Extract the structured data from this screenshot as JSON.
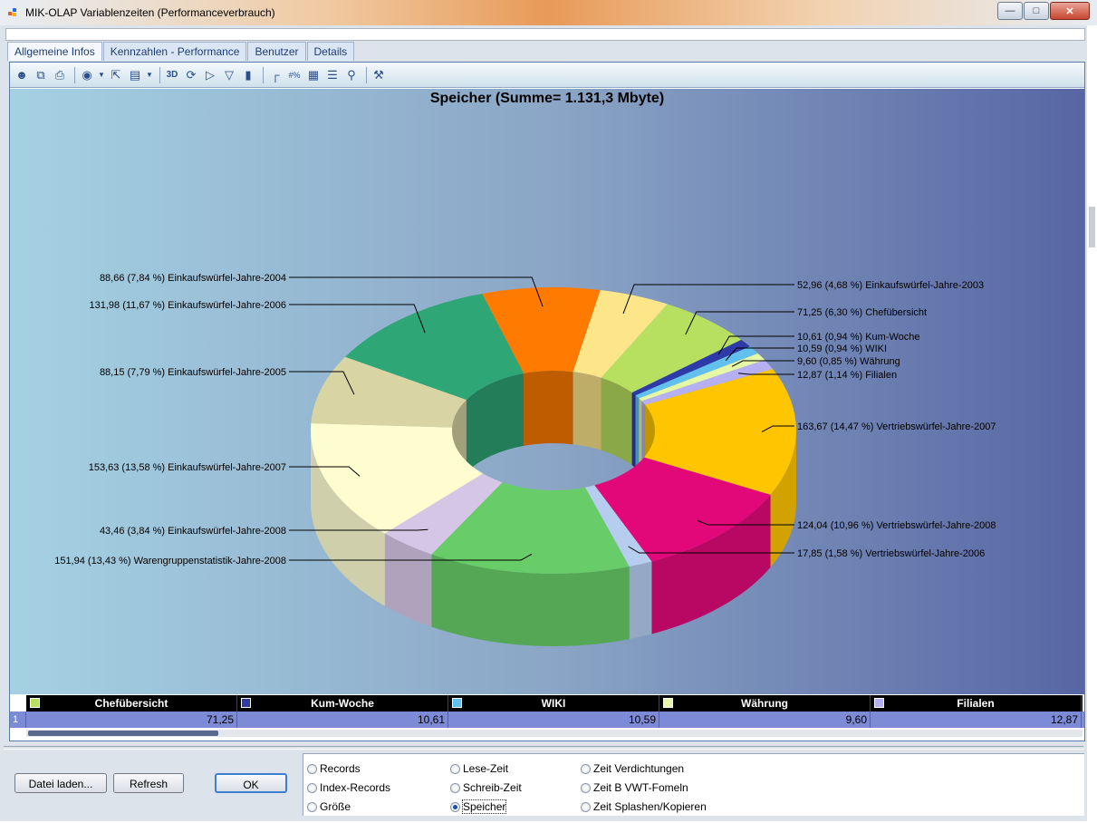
{
  "window": {
    "title": "MIK-OLAP Variablenzeiten (Performanceverbrauch)"
  },
  "tabs": [
    "Allgemeine Infos",
    "Kennzahlen - Performance",
    "Benutzer",
    "Details"
  ],
  "colors": {
    "chart_bg_left": "#a5d1e3",
    "chart_bg_right": "#5766a4",
    "grid_row": "#7d8ad6"
  },
  "chart_data": {
    "type": "pie",
    "title": "Speicher (Summe= 1.131,3 Mbyte)",
    "style": "3d-doughnut",
    "slices": [
      {
        "name": "Chefübersicht",
        "value": 71.25,
        "percent": "6,30",
        "label": "71,25 (6,30 %)  Chefübersicht",
        "color": "#b8e060"
      },
      {
        "name": "Kum-Woche",
        "value": 10.61,
        "percent": "0,94",
        "label": "10,61 (0,94 %)  Kum-Woche",
        "color": "#2e3aa8"
      },
      {
        "name": "WIKI",
        "value": 10.59,
        "percent": "0,94",
        "label": "10,59 (0,94 %)  WIKI",
        "color": "#62c0ee"
      },
      {
        "name": "Währung",
        "value": 9.6,
        "percent": "0,85",
        "label": "9,60 (0,85 %)  Währung",
        "color": "#e6f7a6"
      },
      {
        "name": "Filialen",
        "value": 12.87,
        "percent": "1,14",
        "label": "12,87 (1,14 %)  Filialen",
        "color": "#b6b0f2"
      },
      {
        "name": "Vertriebswürfel-Jahre-2007",
        "value": 163.67,
        "percent": "14,47",
        "label": "163,67 (14,47 %)  Vertriebswürfel-Jahre-2007",
        "color": "#ffc600"
      },
      {
        "name": "Vertriebswürfel-Jahre-2008",
        "value": 124.04,
        "percent": "10,96",
        "label": "124,04 (10,96 %)  Vertriebswürfel-Jahre-2008",
        "color": "#e2087a"
      },
      {
        "name": "Vertriebswürfel-Jahre-2006",
        "value": 17.85,
        "percent": "1,58",
        "label": "17,85 (1,58 %)  Vertriebswürfel-Jahre-2006",
        "color": "#b6cdf0"
      },
      {
        "name": "Warengruppenstatistik-Jahre-2008",
        "value": 151.94,
        "percent": "13,43",
        "label": "151,94 (13,43 %)  Warengruppenstatistik-Jahre-2008",
        "color": "#68cc68"
      },
      {
        "name": "Einkaufswürfel-Jahre-2008",
        "value": 43.46,
        "percent": "3,84",
        "label": "43,46 (3,84 %)  Einkaufswürfel-Jahre-2008",
        "color": "#d6c6e6"
      },
      {
        "name": "Einkaufswürfel-Jahre-2007",
        "value": 153.63,
        "percent": "13,58",
        "label": "153,63 (13,58 %)  Einkaufswürfel-Jahre-2007",
        "color": "#fdfdd0"
      },
      {
        "name": "Einkaufswürfel-Jahre-2005",
        "value": 88.15,
        "percent": "7,79",
        "label": "88,15 (7,79 %)  Einkaufswürfel-Jahre-2005",
        "color": "#d8d4a4"
      },
      {
        "name": "Einkaufswürfel-Jahre-2006",
        "value": 131.98,
        "percent": "11,67",
        "label": "131,98 (11,67 %)  Einkaufswürfel-Jahre-2006",
        "color": "#2ea676"
      },
      {
        "name": "Einkaufswürfel-Jahre-2004",
        "value": 88.66,
        "percent": "7,84",
        "label": "88,66 (7,84 %)  Einkaufswürfel-Jahre-2004",
        "color": "#ff7a00"
      },
      {
        "name": "Einkaufswürfel-Jahre-2003",
        "value": 52.96,
        "percent": "4,68",
        "label": "52,96 (4,68 %)  Einkaufswürfel-Jahre-2003",
        "color": "#fde68a"
      }
    ]
  },
  "grid": {
    "columns": [
      {
        "name": "Chefübersicht",
        "color": "#b8e060",
        "value": "71,25"
      },
      {
        "name": "Kum-Woche",
        "color": "#2e3aa8",
        "value": "10,61"
      },
      {
        "name": "WIKI",
        "color": "#62c0ee",
        "value": "10,59"
      },
      {
        "name": "Währung",
        "color": "#e6f7a6",
        "value": "9,60"
      },
      {
        "name": "Filialen",
        "color": "#b6b0f2",
        "value": "12,87"
      }
    ],
    "row_number": "1"
  },
  "buttons": {
    "load": "Datei laden...",
    "refresh": "Refresh",
    "ok": "OK"
  },
  "options": [
    {
      "label": "Records",
      "selected": false
    },
    {
      "label": "Index-Records",
      "selected": false
    },
    {
      "label": "Größe",
      "selected": false
    },
    {
      "label": "Lese-Zeit",
      "selected": false
    },
    {
      "label": "Schreib-Zeit",
      "selected": false
    },
    {
      "label": "Speicher",
      "selected": true
    },
    {
      "label": "Zeit Verdichtungen",
      "selected": false
    },
    {
      "label": "Zeit B VWT-Fomeln",
      "selected": false
    },
    {
      "label": "Zeit Splashen/Kopieren",
      "selected": false
    }
  ]
}
